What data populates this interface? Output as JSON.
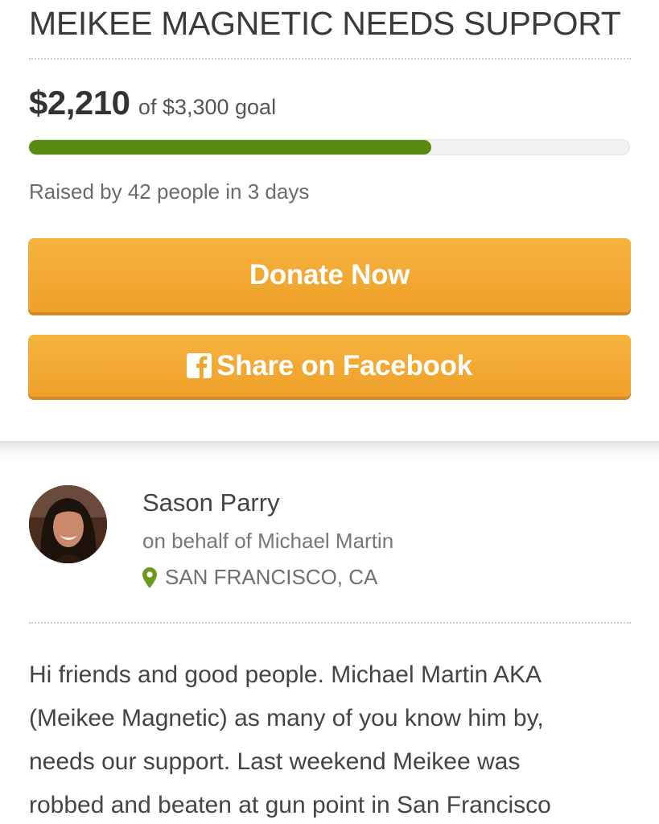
{
  "campaign": {
    "title": "MEIKEE MAGNETIC NEEDS SUPPORT",
    "amount_raised": "$2,210",
    "goal_text": "of $3,300 goal",
    "progress_fraction": 0.67,
    "raised_by_text": "Raised by 42 people in 3 days"
  },
  "buttons": {
    "donate_label": "Donate Now",
    "share_label": "Share on Facebook"
  },
  "organizer": {
    "name": "Sason Parry",
    "on_behalf": "on behalf of Michael Martin",
    "location": "SAN FRANCISCO, CA"
  },
  "story": {
    "text": "Hi friends and good people.  Michael Martin AKA\n(Meikee Magnetic) as many of you know him by,\nneeds our support.  Last weekend Meikee was\nrobbed and beaten at gun point in San Francisco"
  },
  "icons": {
    "facebook": "facebook-icon",
    "location": "map-pin-icon"
  },
  "colors": {
    "progress": "#5a8a12",
    "button": "#f0a52e",
    "pin": "#6a9a1c"
  }
}
